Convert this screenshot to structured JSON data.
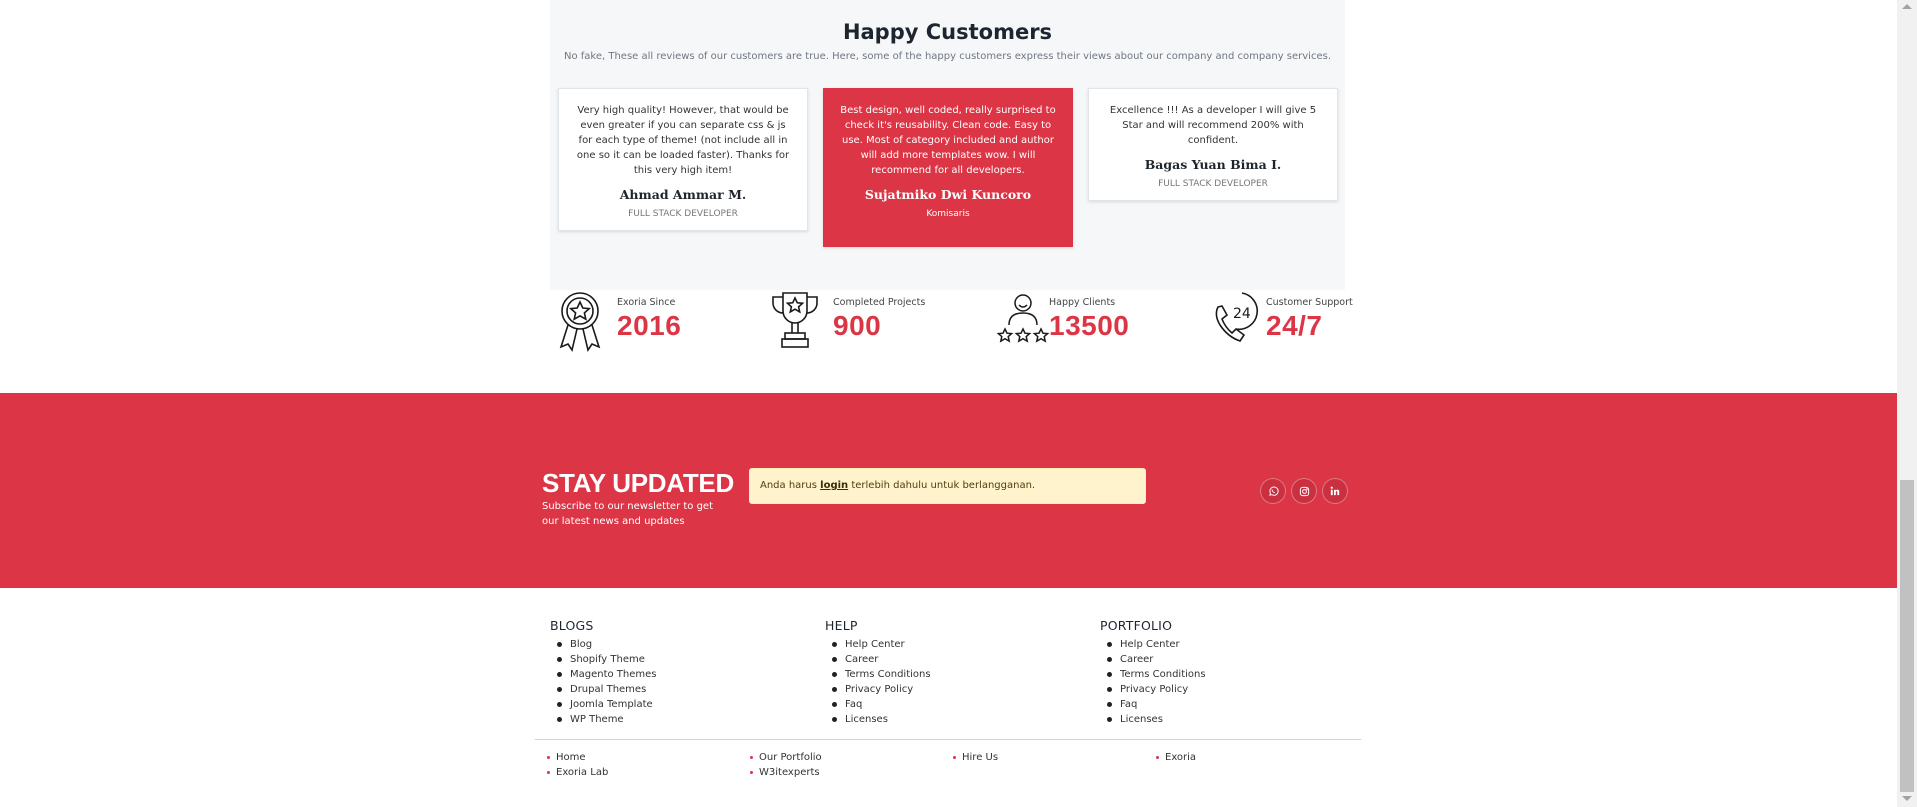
{
  "testimonials": {
    "title": "Happy Customers",
    "subtitle": "No fake, These all reviews of our customers are true. Here, some of the happy customers express their views about our company and company services.",
    "cards": [
      {
        "quote": "Very high quality! However, that would be even greater if you can separate css & js for each type of theme! (not include all in one so it can be loaded faster). Thanks for this very high item!",
        "name": "Ahmad Ammar M.",
        "role": "FULL STACK DEVELOPER"
      },
      {
        "quote": "Best design, well coded, really surprised to check it's reusability. Clean code. Easy to use. Most of category included and author will add more templates wow. I will recommend for all developers.",
        "name": "Sujatmiko Dwi Kuncoro",
        "role": "Komisaris"
      },
      {
        "quote": "Excellence !!! As a developer I will give 5 Star and will recommend 200% with confident.",
        "name": "Bagas Yuan Bima I.",
        "role": "FULL STACK DEVELOPER"
      }
    ]
  },
  "stats": [
    {
      "label": "Exoria Since",
      "value": "2016",
      "icon": "award-ribbon-icon"
    },
    {
      "label": "Completed Projects",
      "value": "900",
      "icon": "trophy-icon"
    },
    {
      "label": "Happy Clients",
      "value": "13500",
      "icon": "happy-client-icon"
    },
    {
      "label": "Customer Support",
      "value": "24/7",
      "icon": "support-24-phone-icon"
    }
  ],
  "newsletter": {
    "title": "STAY UPDATED",
    "subtitle": "Subscribe to our newsletter to get our latest news and updates",
    "alert_before": "Anda harus ",
    "alert_link": "login",
    "alert_after": " terlebih dahulu untuk berlangganan."
  },
  "social": [
    "whatsapp-icon",
    "instagram-icon",
    "linkedin-icon"
  ],
  "footer": {
    "columns": [
      {
        "title": "BLOGS",
        "items": [
          "Blog",
          "Shopify Theme",
          "Magento Themes",
          "Drupal Themes",
          "Joomla Template",
          "WP Theme"
        ]
      },
      {
        "title": "HELP",
        "items": [
          "Help Center",
          "Career",
          "Terms Conditions",
          "Privacy Policy",
          "Faq",
          "Licenses"
        ]
      },
      {
        "title": "PORTFOLIO",
        "items": [
          "Help Center",
          "Career",
          "Terms Conditions",
          "Privacy Policy",
          "Faq",
          "Licenses"
        ]
      }
    ],
    "bottom_links": [
      [
        "Home",
        "Exoria Lab"
      ],
      [
        "Our Portfolio",
        "W3itexperts"
      ],
      [
        "Hire Us"
      ],
      [
        "Exoria"
      ]
    ]
  },
  "colors": {
    "accent": "#dc3545",
    "section_bg": "#f6f7f9",
    "alert_bg": "#fff3cd"
  }
}
